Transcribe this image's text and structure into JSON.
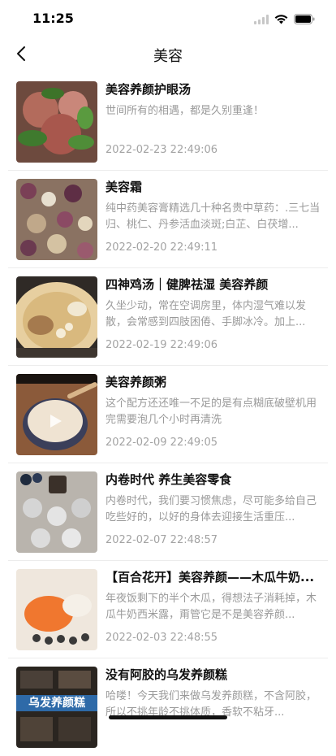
{
  "status": {
    "time": "11:25"
  },
  "nav": {
    "title": "美容"
  },
  "items": [
    {
      "title": "美容养颜护眼汤",
      "desc": "世间所有的相遇，都是久别重逢！",
      "date": "2022-02-23 22:49:06"
    },
    {
      "title": "美容霜",
      "desc": "纯中药美容膏精选几十种名贵中草药：.三七当归、桃仁、丹参活血淡斑;白芷、白茯增...",
      "date": "2022-02-20 22:49:11"
    },
    {
      "title": "四神鸡汤｜健脾祛湿 美容养颜",
      "desc": "久坐少动，常在空调房里，体内湿气难以发散，会常感到四肢困倦、手脚冰冷。加上...",
      "date": "2022-02-19 22:49:06"
    },
    {
      "title": "美容养颜粥",
      "desc": "这个配方还还唯一不足的是有点糊底破壁机用完需要泡几个小时再清洗",
      "date": "2022-02-09 22:49:05"
    },
    {
      "title": "内卷时代 养生美容零食",
      "desc": "内卷时代，我们要习惯焦虑，尽可能多给自己吃些好的，以好的身体去迎接生活重压...",
      "date": "2022-02-07 22:48:57"
    },
    {
      "title": "【百合花开】美容养颜——木瓜牛奶...",
      "desc": "年夜饭剩下的半个木瓜，得想法子消耗掉，木瓜牛奶西米露，甭管它是不是美容养颜...",
      "date": "2022-02-03 22:48:55"
    },
    {
      "title": "没有阿胶的乌发养颜糕",
      "desc": "哈喽！今天我们来做乌发养颜糕，不含阿胶，所以不挑年龄不挑体质，香软不粘牙...",
      "date": "",
      "thumb_text": "乌发养颜糕"
    }
  ]
}
